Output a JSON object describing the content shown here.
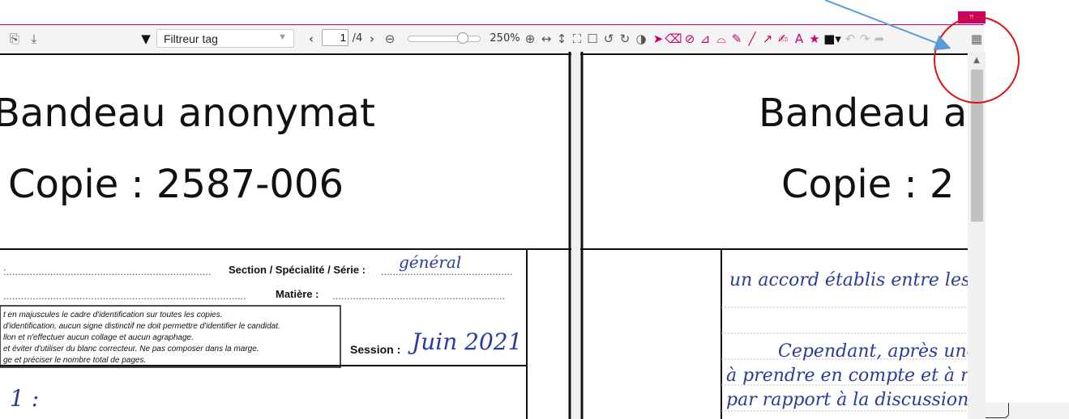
{
  "toolbar": {
    "filter_label": "Filtreur tag",
    "page_current": "1",
    "page_total": "/4",
    "zoom": "250%"
  },
  "page_left": {
    "banner_title": "Bandeau anonymat",
    "copy_id": "Copie : 2587-006",
    "field_section": "Section / Spécialité / Série :",
    "field_matiere": "Matière :",
    "field_session": "Session :",
    "handwriting_section": "général",
    "handwriting_session": "Juin 2021",
    "instructions": [
      "t en majuscules le cadre d'identification sur toutes les copies.",
      "d'identification, aucun signe distinctif ne doit permettre d'identifier le candidat.",
      "llon et n'effectuer aucun collage et aucun agraphage.",
      "et éviter d'utiliser du blanc correcteur. Ne pas composer dans la marge.",
      "ge et préciser le nombre total de pages."
    ],
    "item_number": "1 :"
  },
  "page_right": {
    "banner_title": "Bandeau a",
    "copy_id": "Copie : 2",
    "handwriting_lines": [
      "un accord établis entre les",
      "Cependant, après une mig",
      "à prendre en compte et à rel",
      "par rapport à la discussion"
    ]
  },
  "colors": {
    "accent": "#c9006b",
    "annotation_circle": "#e01010",
    "annotation_arrow": "#5b9bd5",
    "handwriting": "#2a3b9e"
  }
}
